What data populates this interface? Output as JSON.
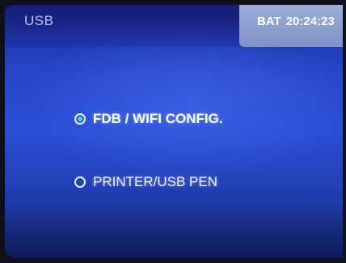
{
  "header": {
    "title": "USB",
    "battery_label": "BAT",
    "clock": "20:24:23"
  },
  "options": [
    {
      "label": "FDB / WIFI CONFIG.",
      "selected": true
    },
    {
      "label": "PRINTER/USB PEN",
      "selected": false
    }
  ],
  "colors": {
    "background": "#2747c9",
    "status_box": "#8ea2d0",
    "radio_selected": "#38d6e6",
    "text": "#ffffff"
  }
}
